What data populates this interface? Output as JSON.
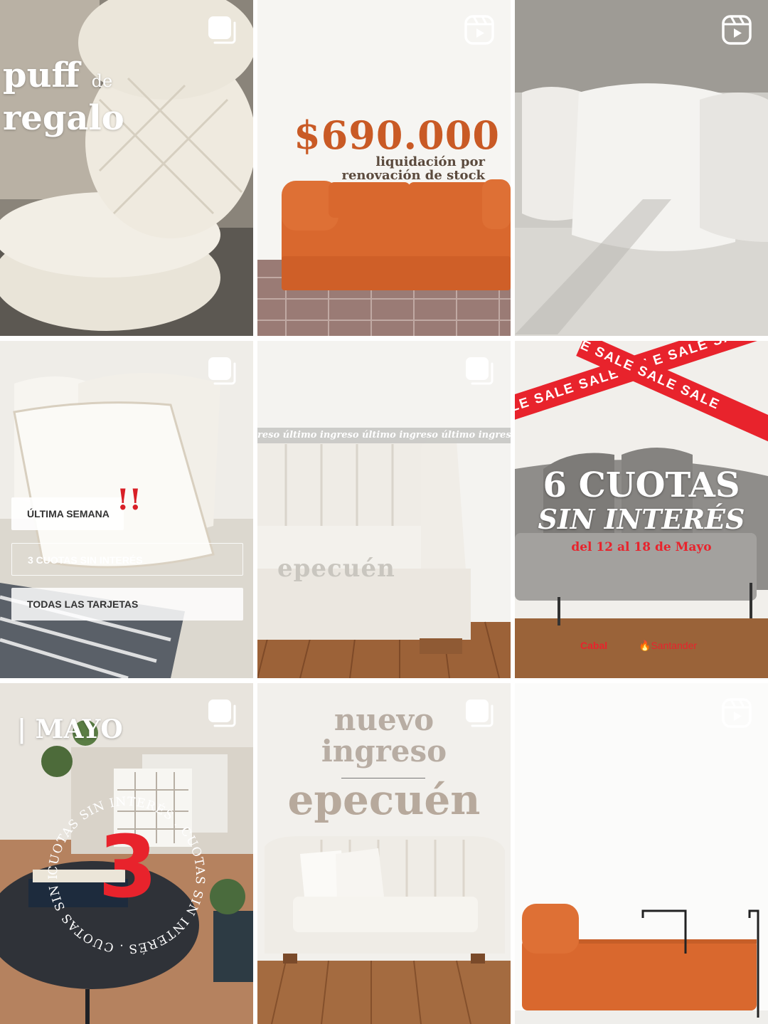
{
  "posts": [
    {
      "type": "carousel",
      "title_line1": "puff",
      "title_small": "de",
      "title_line2": "regalo"
    },
    {
      "type": "reel",
      "price": "$690.000",
      "subtitle_line1": "liquidación por",
      "subtitle_line2": "renovación de stock"
    },
    {
      "type": "reel"
    },
    {
      "type": "carousel",
      "chip1": "ÚLTIMA SEMANA",
      "exclamation": "!!",
      "chip2": "3 CUOTAS SIN INTERÉS",
      "chip3": "TODAS LAS TARJETAS"
    },
    {
      "type": "carousel",
      "ribbon": "reso  último ingreso último ingreso último ingreso último ingre",
      "brand": "epecuén"
    },
    {
      "type": "none",
      "sale_band_a": "SALE SALE SALE SALE SALE SALE SAL",
      "sale_band_b": "E SALE SALE SALE",
      "headline_line1": "6 CUOTAS",
      "headline_line2": "SIN INTERÉS",
      "dates": "del 12 al 18 de Mayo",
      "logo1": "Cabal",
      "logo2": "Santander"
    },
    {
      "type": "carousel",
      "month": "| MAYO",
      "big_number": "3",
      "circular_text": "CUOTAS SIN INTERÉS . CUOTAS SIN INTERÉS . CUOTAS SIN INTERÉS ."
    },
    {
      "type": "carousel",
      "title_line1": "nuevo",
      "title_line2": "ingreso",
      "brand": "epecuén"
    },
    {
      "type": "reel"
    }
  ],
  "colors": {
    "price_orange": "#c95a25",
    "sofa_orange": "#d9682e",
    "sale_red": "#e8232c",
    "indicator_white": "#ffffff"
  },
  "icons": {
    "carousel": "carousel-icon",
    "reel": "reel-icon"
  }
}
